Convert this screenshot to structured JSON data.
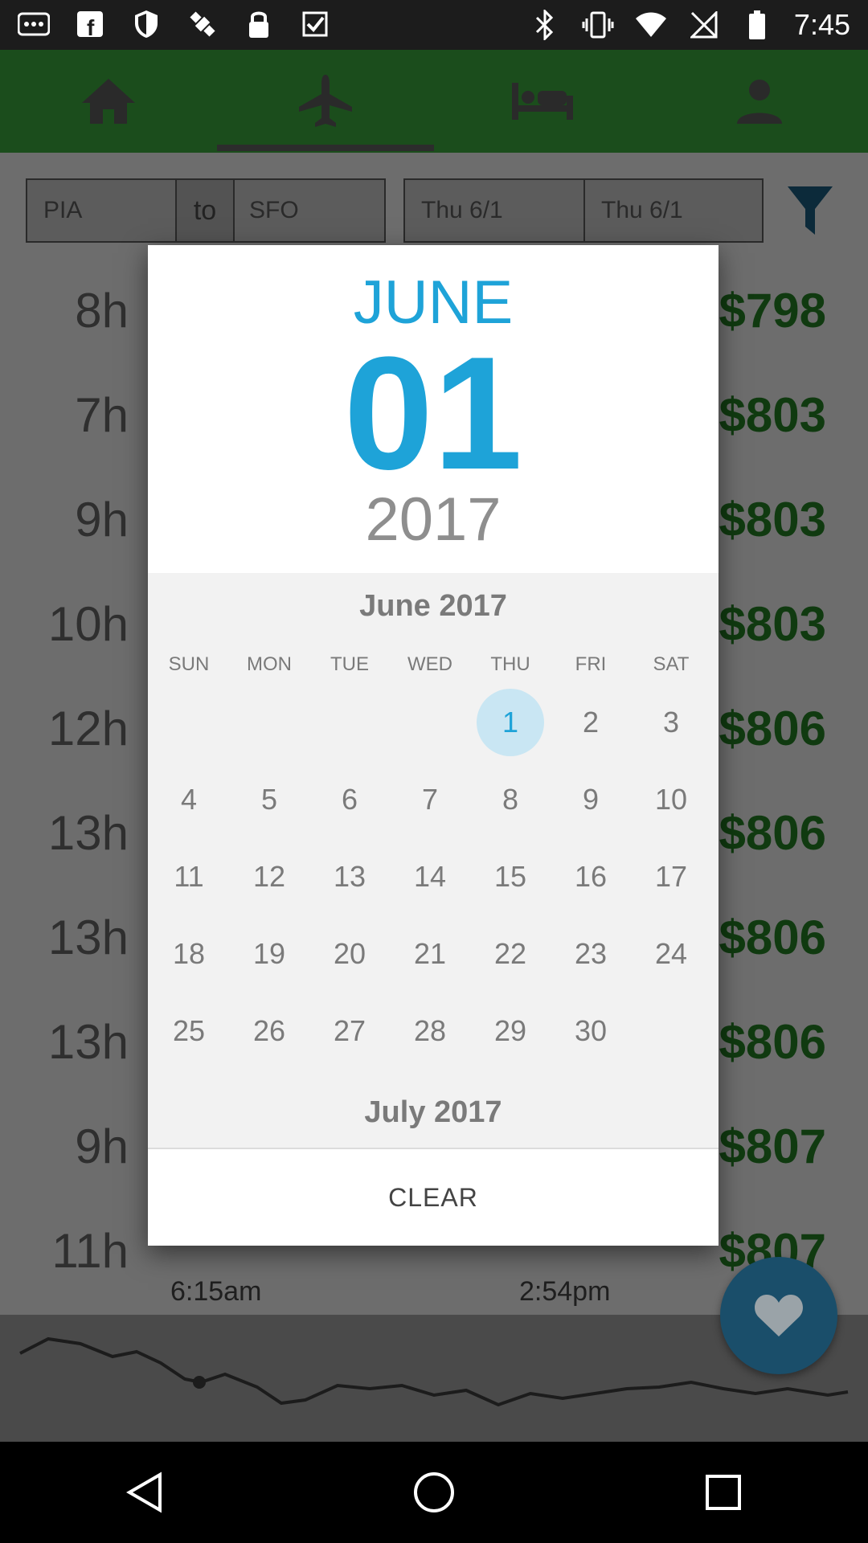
{
  "status_bar": {
    "time": "7:45",
    "left_icons": [
      "more-dots-icon",
      "facebook-icon",
      "shield-icon",
      "satellite-icon",
      "lock-icon",
      "check-icon"
    ],
    "right_icons": [
      "bluetooth-icon",
      "vibrate-icon",
      "wifi-icon",
      "no-sim-icon",
      "battery-icon"
    ]
  },
  "top_nav": {
    "tabs": [
      "home-icon",
      "flight-icon",
      "hotel-icon",
      "profile-icon"
    ],
    "selected": 1
  },
  "search": {
    "origin": "PIA",
    "to_label": "to",
    "destination": "SFO",
    "depart_date": "Thu 6/1",
    "return_date": "Thu 6/1"
  },
  "results": [
    {
      "duration": "8h",
      "price": "$798"
    },
    {
      "duration": "7h",
      "price": "$803"
    },
    {
      "duration": "9h",
      "price": "$803"
    },
    {
      "duration": "10h",
      "price": "$803"
    },
    {
      "duration": "12h",
      "price": "$806"
    },
    {
      "duration": "13h",
      "price": "$806"
    },
    {
      "duration": "13h",
      "price": "$806"
    },
    {
      "duration": "13h",
      "price": "$806"
    },
    {
      "duration": "9h",
      "price": "$807"
    },
    {
      "duration": "11h",
      "price": "$807",
      "depart_time": "6:15am",
      "arrive_time": "2:54pm"
    }
  ],
  "date_picker": {
    "header_month": "JUNE",
    "header_day": "01",
    "header_year": "2017",
    "month_title": "June 2017",
    "next_month_title": "July 2017",
    "weekdays": [
      "SUN",
      "MON",
      "TUE",
      "WED",
      "THU",
      "FRI",
      "SAT"
    ],
    "first_weekday_index": 4,
    "days_in_month": 30,
    "selected_day": 1,
    "clear_label": "CLEAR"
  },
  "colors": {
    "accent": "#1ea3d8",
    "selected_bg": "#c9e6f3",
    "price_green": "#103a10",
    "nav_bg": "#1b4d1c"
  }
}
